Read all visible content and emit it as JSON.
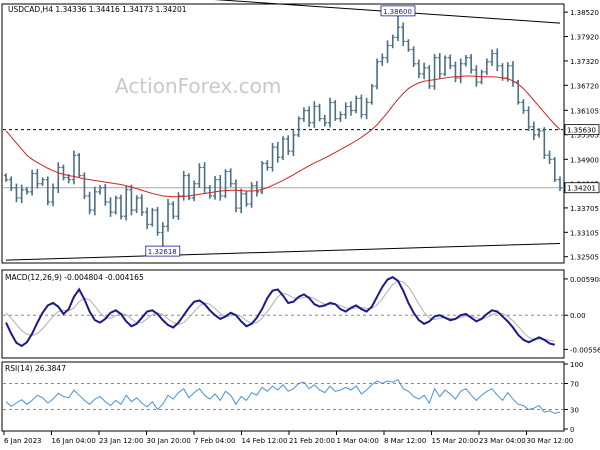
{
  "watermark": "ActionForex.com",
  "chart_data": [
    {
      "id": "price",
      "type": "bar",
      "title": "USDCAD,H4  1.34336 1.34416 1.34173 1.34201",
      "x_tick_labels": [
        "6 Jan 2023",
        "16 Jan 04:00",
        "23 Jan 12:00",
        "30 Jan 20:00",
        "7 Feb 04:00",
        "14 Feb 12:00",
        "21 Feb 20:00",
        "1 Mar 04:00",
        "8 Mar 12:00",
        "15 Mar 20:00",
        "23 Mar 04:00",
        "30 Mar 12:00"
      ],
      "y_ticks": [
        1.32505,
        1.33105,
        1.33705,
        1.34305,
        1.349,
        1.35505,
        1.36105,
        1.3672,
        1.3732,
        1.3792,
        1.3852
      ],
      "ylim": [
        1.3235,
        1.3872
      ],
      "horizontal_line": {
        "value": 1.3563,
        "label": "1.35630",
        "style": "dashed"
      },
      "last_price": {
        "value": 1.34201,
        "label": "1.34201"
      },
      "annotations": [
        {
          "label": "1.38600",
          "value": 1.386,
          "x_index": 75
        },
        {
          "label": "1.32618",
          "value": 1.32618,
          "x_index": 30
        }
      ],
      "trendlines": [
        {
          "name": "upper",
          "points": [
            [
              0,
              1.3918
            ],
            [
              106,
              1.3825
            ]
          ]
        },
        {
          "name": "lower",
          "points": [
            [
              0,
              1.3242
            ],
            [
              106,
              1.3283
            ]
          ]
        }
      ],
      "series": [
        {
          "type": "ohlc",
          "color": "#4a6f87",
          "close": [
            1.344,
            1.342,
            1.3395,
            1.3415,
            1.341,
            1.3455,
            1.343,
            1.344,
            1.3385,
            1.342,
            1.347,
            1.3445,
            1.344,
            1.35,
            1.345,
            1.34,
            1.3365,
            1.341,
            1.342,
            1.3385,
            1.336,
            1.3395,
            1.335,
            1.3415,
            1.3365,
            1.3395,
            1.336,
            1.333,
            1.3365,
            1.331,
            1.3325,
            1.338,
            1.335,
            1.34,
            1.345,
            1.3395,
            1.343,
            1.347,
            1.342,
            1.34,
            1.344,
            1.34,
            1.346,
            1.343,
            1.337,
            1.3405,
            1.338,
            1.3425,
            1.341,
            1.348,
            1.347,
            1.352,
            1.3495,
            1.354,
            1.351,
            1.355,
            1.359,
            1.361,
            1.358,
            1.362,
            1.359,
            1.358,
            1.363,
            1.359,
            1.36,
            1.362,
            1.361,
            1.364,
            1.36,
            1.363,
            1.367,
            1.373,
            1.374,
            1.377,
            1.379,
            1.3815,
            1.378,
            1.376,
            1.3725,
            1.37,
            1.3715,
            1.367,
            1.374,
            1.37,
            1.374,
            1.372,
            1.369,
            1.3725,
            1.374,
            1.371,
            1.368,
            1.3705,
            1.373,
            1.375,
            1.372,
            1.369,
            1.372,
            1.368,
            1.363,
            1.361,
            1.357,
            1.355,
            1.356,
            1.35,
            1.349,
            1.344,
            1.342
          ]
        },
        {
          "type": "line",
          "color": "#d22424",
          "values": [
            1.356,
            1.3545,
            1.353,
            1.3515,
            1.35,
            1.349,
            1.3482,
            1.3475,
            1.3468,
            1.3462,
            1.3457,
            1.3453,
            1.345,
            1.3448,
            1.3445,
            1.3442,
            1.344,
            1.3438,
            1.3436,
            1.3434,
            1.3432,
            1.343,
            1.3428,
            1.3425,
            1.3422,
            1.3418,
            1.3414,
            1.341,
            1.3406,
            1.3403,
            1.34,
            1.3399,
            1.3398,
            1.3398,
            1.3399,
            1.34,
            1.3402,
            1.3404,
            1.3406,
            1.3408,
            1.341,
            1.3412,
            1.3413,
            1.3414,
            1.3414,
            1.3413,
            1.3412,
            1.3412,
            1.3413,
            1.3416,
            1.342,
            1.3426,
            1.3432,
            1.3438,
            1.3445,
            1.3452,
            1.346,
            1.3467,
            1.3474,
            1.3481,
            1.3487,
            1.3493,
            1.35,
            1.3507,
            1.3514,
            1.3521,
            1.3528,
            1.3536,
            1.3544,
            1.3553,
            1.3563,
            1.3575,
            1.359,
            1.3605,
            1.3622,
            1.3638,
            1.3652,
            1.3664,
            1.3672,
            1.3678,
            1.3682,
            1.3684,
            1.3686,
            1.3688,
            1.369,
            1.3692,
            1.3693,
            1.3694,
            1.3695,
            1.3695,
            1.3694,
            1.3693,
            1.3693,
            1.3693,
            1.3692,
            1.369,
            1.3688,
            1.3683,
            1.3675,
            1.3664,
            1.365,
            1.3635,
            1.362,
            1.3605,
            1.359,
            1.3576,
            1.3563
          ]
        }
      ]
    },
    {
      "id": "macd",
      "type": "line",
      "title": "MACD(12,26,9) -0.004804 -0.004165",
      "y_ticks": [
        0.005908,
        0.0,
        -0.005563
      ],
      "y_tick_labels": [
        "0.005908",
        "0.00",
        "-0.005563"
      ],
      "ylim": [
        -0.0068,
        0.0072
      ],
      "series": [
        {
          "name": "MACD",
          "color": "#1a1a8c",
          "values": [
            -0.0012,
            -0.003,
            -0.0045,
            -0.005,
            -0.0044,
            -0.003,
            -0.0012,
            0.0004,
            0.0016,
            0.002,
            0.0014,
            0.0002,
            0.001,
            0.003,
            0.0042,
            0.0026,
            0.0006,
            -0.0008,
            -0.0012,
            -0.0006,
            0.0004,
            0.0008,
            0.0002,
            -0.001,
            -0.0018,
            -0.0014,
            -0.0004,
            0.0006,
            0.0008,
            0.0002,
            -0.0008,
            -0.0016,
            -0.002,
            -0.0012,
            0.0,
            0.0012,
            0.0022,
            0.0024,
            0.0018,
            0.0008,
            0.0,
            -0.0006,
            -0.0002,
            0.0004,
            0.0,
            -0.001,
            -0.0018,
            -0.0014,
            -0.0004,
            0.001,
            0.0028,
            0.004,
            0.0042,
            0.0032,
            0.002,
            0.0022,
            0.003,
            0.0034,
            0.0028,
            0.0018,
            0.0014,
            0.0016,
            0.002,
            0.0018,
            0.001,
            0.0006,
            0.0012,
            0.0016,
            0.001,
            0.0006,
            0.0014,
            0.003,
            0.0046,
            0.0058,
            0.0062,
            0.0056,
            0.004,
            0.002,
            0.0004,
            -0.0008,
            -0.0014,
            -0.001,
            -0.0002,
            0.0,
            -0.0004,
            -0.0008,
            -0.0006,
            0.0,
            0.0002,
            -0.0004,
            -0.001,
            -0.0006,
            0.0002,
            0.0008,
            0.0006,
            -0.0002,
            -0.001,
            -0.002,
            -0.0032,
            -0.004,
            -0.0044,
            -0.004,
            -0.0036,
            -0.004,
            -0.0046,
            -0.0048
          ]
        },
        {
          "name": "Signal",
          "color": "#b0b0b0",
          "values": [
            0.0004,
            -0.0005,
            -0.0015,
            -0.0025,
            -0.0031,
            -0.0033,
            -0.003,
            -0.0022,
            -0.0012,
            -0.0002,
            0.0006,
            0.0008,
            0.0007,
            0.0012,
            0.0022,
            0.0028,
            0.0025,
            0.0015,
            0.0004,
            -0.0004,
            -0.0005,
            -0.0001,
            0.0003,
            0.0001,
            -0.0006,
            -0.0012,
            -0.0012,
            -0.0006,
            0.0001,
            0.0004,
            0.0001,
            -0.0006,
            -0.0012,
            -0.0015,
            -0.0012,
            -0.0004,
            0.0006,
            0.0015,
            0.002,
            0.0018,
            0.0011,
            0.0003,
            -0.0002,
            -0.0001,
            0.0001,
            -0.0002,
            -0.0009,
            -0.0013,
            -0.0012,
            -0.0005,
            0.0006,
            0.0018,
            0.003,
            0.0036,
            0.0033,
            0.0028,
            0.0027,
            0.0029,
            0.003,
            0.0027,
            0.0022,
            0.0018,
            0.0017,
            0.0018,
            0.0016,
            0.0012,
            0.001,
            0.0012,
            0.0013,
            0.0011,
            0.0011,
            0.0017,
            0.0027,
            0.0039,
            0.005,
            0.0056,
            0.0054,
            0.0046,
            0.0033,
            0.0018,
            0.0005,
            -0.0004,
            -0.0007,
            -0.0005,
            -0.0004,
            -0.0005,
            -0.0006,
            -0.0004,
            -0.0001,
            -0.0001,
            -0.0004,
            -0.0006,
            -0.0004,
            0.0001,
            0.0004,
            0.0003,
            -0.0002,
            -0.0009,
            -0.0018,
            -0.0028,
            -0.0036,
            -0.0039,
            -0.0039,
            -0.0039,
            -0.0041,
            -0.0042
          ]
        }
      ]
    },
    {
      "id": "rsi",
      "type": "line",
      "title": "RSI(14) 26.3847",
      "y_ticks": [
        100,
        70,
        30,
        0
      ],
      "y_tick_labels": [
        "100",
        "70",
        "30",
        "0"
      ],
      "levels": [
        70,
        30
      ],
      "ylim": [
        0,
        100
      ],
      "series": [
        {
          "name": "RSI",
          "color": "#4a90d9",
          "values": [
            42,
            35,
            40,
            45,
            38,
            44,
            52,
            48,
            40,
            46,
            55,
            50,
            48,
            60,
            52,
            44,
            38,
            46,
            50,
            42,
            36,
            44,
            38,
            52,
            42,
            48,
            40,
            34,
            42,
            30,
            38,
            52,
            46,
            56,
            62,
            48,
            56,
            62,
            52,
            46,
            54,
            44,
            58,
            52,
            38,
            50,
            44,
            56,
            52,
            64,
            58,
            66,
            60,
            68,
            58,
            62,
            70,
            72,
            62,
            68,
            60,
            56,
            66,
            58,
            60,
            64,
            60,
            66,
            54,
            60,
            68,
            74,
            70,
            74,
            72,
            76,
            62,
            58,
            50,
            46,
            52,
            40,
            62,
            50,
            60,
            54,
            46,
            58,
            62,
            52,
            44,
            52,
            58,
            62,
            52,
            44,
            56,
            46,
            38,
            36,
            30,
            32,
            36,
            26,
            28,
            24,
            26
          ]
        }
      ]
    }
  ]
}
